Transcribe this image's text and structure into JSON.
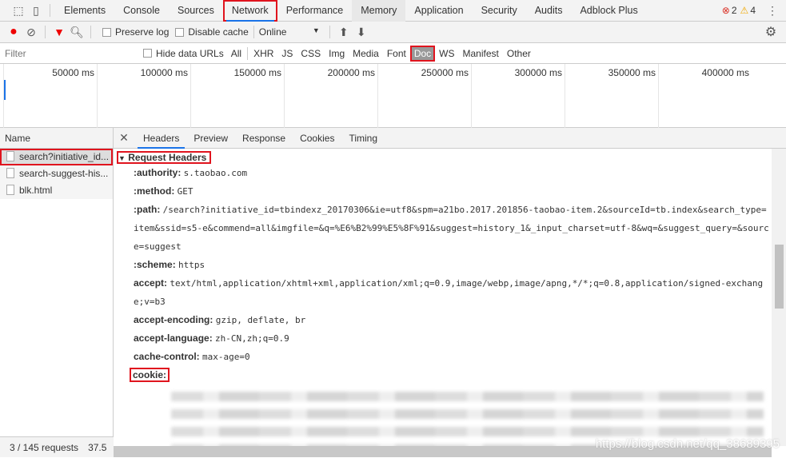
{
  "tabs": [
    "Elements",
    "Console",
    "Sources",
    "Network",
    "Performance",
    "Memory",
    "Application",
    "Security",
    "Audits",
    "Adblock Plus"
  ],
  "errors": "2",
  "warnings": "4",
  "toolbar": {
    "preserve_log": "Preserve log",
    "disable_cache": "Disable cache",
    "throttle": "Online"
  },
  "filter": {
    "placeholder": "Filter",
    "hide_data_urls": "Hide data URLs",
    "types": [
      "All",
      "XHR",
      "JS",
      "CSS",
      "Img",
      "Media",
      "Font",
      "Doc",
      "WS",
      "Manifest",
      "Other"
    ]
  },
  "timeline": [
    "50000 ms",
    "100000 ms",
    "150000 ms",
    "200000 ms",
    "250000 ms",
    "300000 ms",
    "350000 ms",
    "400000 ms"
  ],
  "requests": {
    "header": "Name",
    "items": [
      "search?initiative_id...",
      "search-suggest-his...",
      "blk.html"
    ],
    "status": "3 / 145 requests",
    "size": "37.5"
  },
  "detail_tabs": [
    "Headers",
    "Preview",
    "Response",
    "Cookies",
    "Timing"
  ],
  "section": "Request Headers",
  "headers": [
    {
      "k": ":authority:",
      "v": "s.taobao.com"
    },
    {
      "k": ":method:",
      "v": "GET"
    },
    {
      "k": ":path:",
      "v": "/search?initiative_id=tbindexz_20170306&ie=utf8&spm=a21bo.2017.201856-taobao-item.2&sourceId=tb.index&search_type=item&ssid=s5-e&commend=all&imgfile=&q=%E6%B2%99%E5%8F%91&suggest=history_1&_input_charset=utf-8&wq=&suggest_query=&source=suggest"
    },
    {
      "k": ":scheme:",
      "v": "https"
    },
    {
      "k": "accept:",
      "v": "text/html,application/xhtml+xml,application/xml;q=0.9,image/webp,image/apng,*/*;q=0.8,application/signed-exchange;v=b3"
    },
    {
      "k": "accept-encoding:",
      "v": "gzip, deflate, br"
    },
    {
      "k": "accept-language:",
      "v": "zh-CN,zh;q=0.9"
    },
    {
      "k": "cache-control:",
      "v": "max-age=0"
    }
  ],
  "cookie_label": "cookie:",
  "watermark": "https://blog.csdn.net/qq_38689395"
}
